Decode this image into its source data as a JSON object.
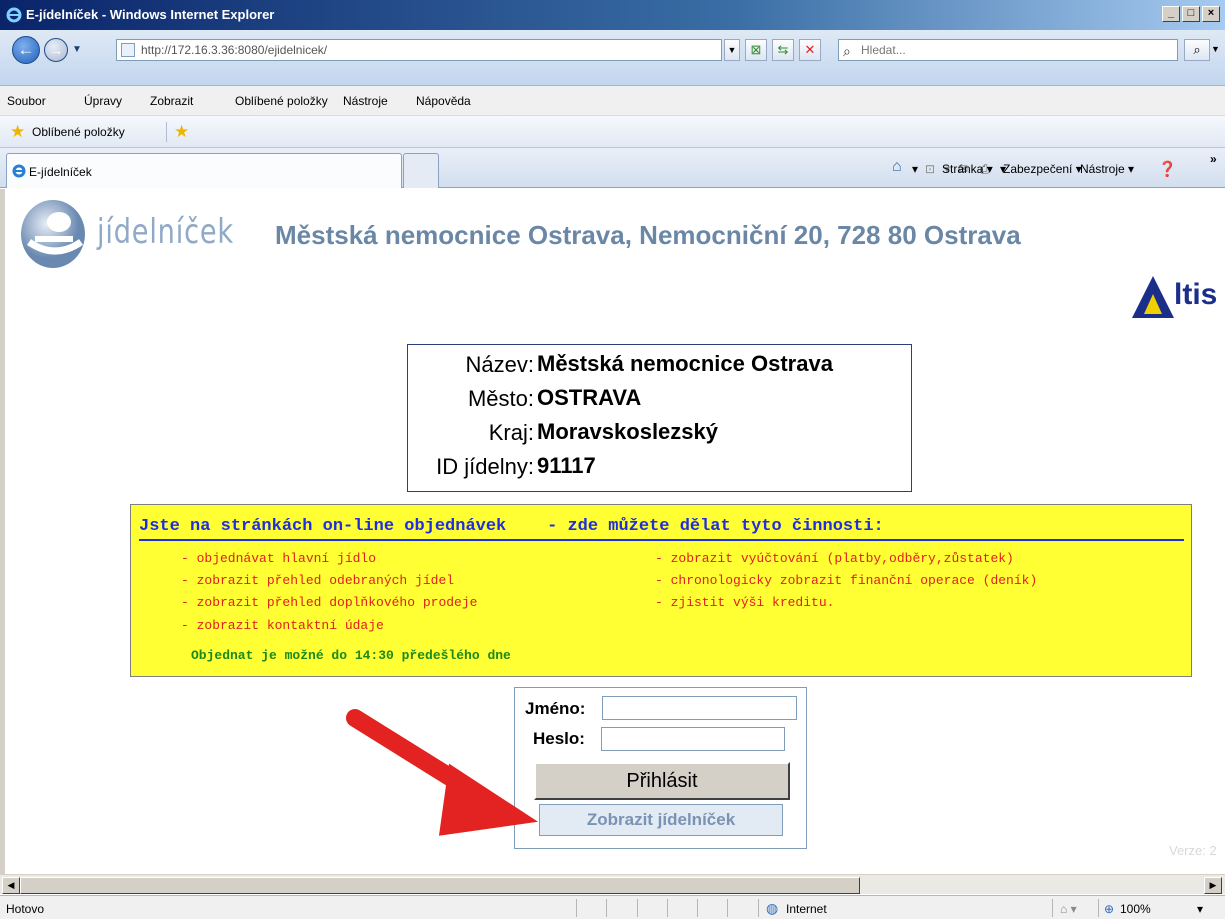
{
  "window": {
    "title": "E-jídelníček - Windows Internet Explorer",
    "min": "_",
    "max": "□",
    "close": "×"
  },
  "address": {
    "url": "http://172.16.3.36:8080/ejidelnicek/",
    "search_placeholder": "Hledat..."
  },
  "menu": [
    "Soubor",
    "Úpravy",
    "Zobrazit",
    "Oblíbené položky",
    "Nástroje",
    "Nápověda"
  ],
  "favorites": {
    "label": "Oblíbené položky"
  },
  "tab": {
    "title": "E-jídelníček"
  },
  "commands": {
    "page": "Stránka ▾",
    "security": "Zabezpečení ▾",
    "tools": "Nástroje ▾",
    "more": "»"
  },
  "page": {
    "logo_text": "jídelníček",
    "headline": "Městská nemocnice Ostrava, Nemocniční 20, 728 80 Ostrava",
    "altis_logo": "ltis",
    "info": [
      {
        "label": "Název:",
        "value": "Městská nemocnice Ostrava"
      },
      {
        "label": "Město:",
        "value": "OSTRAVA"
      },
      {
        "label": "Kraj:",
        "value": "Moravskoslezský"
      },
      {
        "label": "ID jídelny:",
        "value": "91117"
      }
    ],
    "banner_title": "Jste na stránkách on-line objednávek    - zde můžete dělat tyto činnosti:",
    "left_actions": [
      "- objednávat hlavní jídlo",
      "- zobrazit přehled odebraných jídel",
      "- zobrazit přehled doplňkového prodeje",
      "- zobrazit kontaktní údaje"
    ],
    "right_actions": [
      "- zobrazit vyúčtování (platby,odběry,zůstatek)",
      "- chronologicky zobrazit finanční operace (deník)",
      "- zjistit výši kreditu."
    ],
    "order_note": "Objednat je možné do 14:30 předešlého dne",
    "login": {
      "name_label": "Jméno:",
      "password_label": "Heslo:",
      "name_value": "",
      "password_value": "",
      "login_button": "Přihlásit",
      "menu_button": "Zobrazit jídelníček"
    },
    "version": "Verze: 2"
  },
  "status": {
    "left": "Hotovo",
    "zone": "Internet",
    "zoom": "100%"
  },
  "colors": {
    "banner_bg": "#ffff33",
    "banner_title": "#1f2ee0",
    "actions": "#e01f1f",
    "note": "#1a8a1a",
    "headline": "#6b87a6",
    "arrow": "#e32222"
  }
}
